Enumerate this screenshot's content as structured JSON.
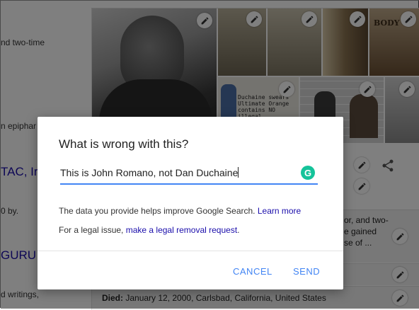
{
  "background": {
    "left_snippets": [
      {
        "text": "nd two-time",
        "link": false
      },
      {
        "text": "n epiphar",
        "link": false
      },
      {
        "text": "TAC, Ir",
        "link": true
      },
      {
        "text": "0 by.",
        "link": false
      },
      {
        "text": "GURU",
        "link": true
      },
      {
        "text": "d writings,",
        "link": false
      }
    ],
    "side_text": [
      "or, and two-",
      "e gained",
      "se of ..."
    ],
    "died_label": "Died:",
    "died_value": "January 12, 2000, Carlsbad, California, United States",
    "image_texts": {
      "book_caption": "Duchaine swears Ultimate Orange contains NO illegal",
      "book_cover": "BODY"
    }
  },
  "dialog": {
    "title": "What is wrong with this?",
    "input_value": "This is John Romano, not Dan Duchaine",
    "grammarly_glyph": "G",
    "info_text": "The data you provide helps improve Google Search.",
    "learn_more": "Learn more",
    "legal_prefix": "For a legal issue,",
    "legal_link": "make a legal removal request",
    "legal_suffix": ".",
    "cancel_label": "CANCEL",
    "send_label": "SEND"
  },
  "colors": {
    "accent": "#4285f4",
    "link": "#1a0dab",
    "grammarly": "#15c39a",
    "overlay": "rgba(0,0,0,0.5)"
  },
  "icons": [
    "pencil-icon",
    "share-icon",
    "grammarly-icon"
  ]
}
